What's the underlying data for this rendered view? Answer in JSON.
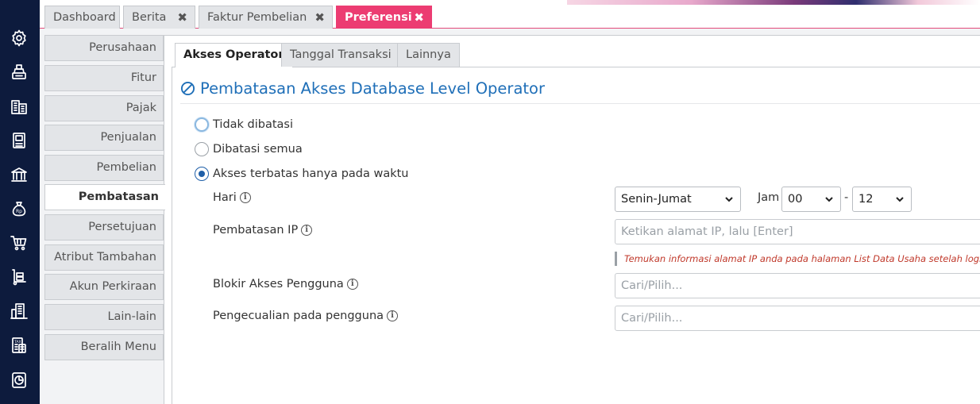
{
  "tabs": [
    {
      "label": "Dashboard",
      "closable": false,
      "active": false
    },
    {
      "label": "Berita",
      "closable": true,
      "active": false
    },
    {
      "label": "Faktur Pembelian",
      "closable": true,
      "active": false
    },
    {
      "label": "Preferensi",
      "closable": true,
      "active": true
    }
  ],
  "rail_icons": [
    "settings-icon",
    "cash-register-icon",
    "building-icon",
    "book-icon",
    "bank-icon",
    "money-bag-icon",
    "cart-icon",
    "hand-truck-icon",
    "company-icon",
    "tax-icon",
    "report-icon"
  ],
  "side_menu": [
    {
      "label": "Perusahaan",
      "active": false
    },
    {
      "label": "Fitur",
      "active": false
    },
    {
      "label": "Pajak",
      "active": false
    },
    {
      "label": "Penjualan",
      "active": false
    },
    {
      "label": "Pembelian",
      "active": false
    },
    {
      "label": "Pembatasan",
      "active": true
    },
    {
      "label": "Persetujuan",
      "active": false
    },
    {
      "label": "Atribut Tambahan",
      "active": false
    },
    {
      "label": "Akun Perkiraan",
      "active": false
    },
    {
      "label": "Lain-lain",
      "active": false
    },
    {
      "label": "Beralih Menu",
      "active": false
    }
  ],
  "subtabs": [
    {
      "label": "Akses Operator",
      "active": true
    },
    {
      "label": "Tanggal Transaksi",
      "active": false
    },
    {
      "label": "Lainnya",
      "active": false
    }
  ],
  "section": {
    "title": "Pembatasan Akses Database Level Operator",
    "icon": "ban-icon"
  },
  "radios": [
    {
      "label": "Tidak dibatasi",
      "checked": false
    },
    {
      "label": "Dibatasi semua",
      "checked": false
    },
    {
      "label": "Akses terbatas hanya pada waktu",
      "checked": true
    }
  ],
  "form": {
    "hari_label": "Hari",
    "hari_value": "Senin-Jumat",
    "jam_label": "Jam",
    "jam_from": "00",
    "jam_separator": "-",
    "jam_to": "12",
    "ip_label": "Pembatasan IP",
    "ip_placeholder": "Ketikan alamat IP, lalu [Enter]",
    "ip_hint": "Temukan informasi alamat IP anda pada halaman List Data Usaha setelah login",
    "blokir_label": "Blokir Akses Pengguna",
    "blokir_placeholder": "Cari/Pilih...",
    "pengecualian_label": "Pengecualian pada pengguna",
    "pengecualian_placeholder": "Cari/Pilih..."
  },
  "colors": {
    "rail": "#0d1b3d",
    "accent": "#ec3c72",
    "title": "#1f6fb8",
    "hint": "#c0392b"
  }
}
